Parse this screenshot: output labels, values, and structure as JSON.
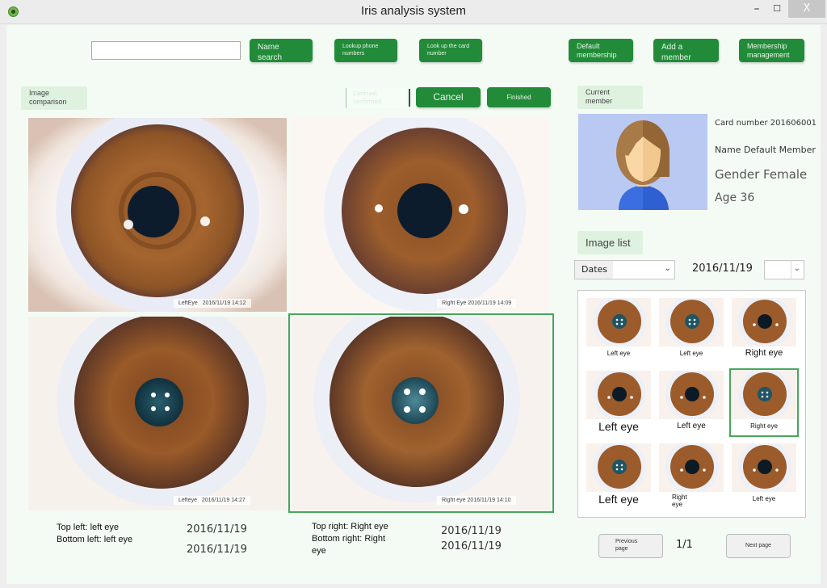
{
  "window": {
    "title": "Iris analysis system",
    "minimize_glyph": "–",
    "maximize_glyph": "☐",
    "close_glyph": "X"
  },
  "toolbar": {
    "search_value": "",
    "name_search": "Name search",
    "lookup_phone": "Lookup phone numbers",
    "lookup_card": "Look up the card number",
    "default_membership": "Default membership",
    "add_member": "Add a member",
    "membership_management": "Membership management"
  },
  "comparison": {
    "section_label": "Image comparison",
    "faded_button": "Contrast confirmed",
    "cancel": "Cancel",
    "finished": "Finished",
    "images": [
      {
        "caption_eye": "LeftEye",
        "caption_time": "2016/11/19 14:12",
        "position": "top-left"
      },
      {
        "caption_eye": "Right Eye",
        "caption_time": "2016/11/19 14:09",
        "position": "top-right"
      },
      {
        "caption_eye": "Lefteye",
        "caption_time": "2016/11/19 14:27",
        "position": "bottom-left"
      },
      {
        "caption_eye": "Right eye",
        "caption_time": "2016/11/19 14:10",
        "position": "bottom-right",
        "selected": true
      }
    ],
    "left_summary": "Top left: left eye Bottom left: left eye",
    "left_date_1": "2016/11/19",
    "left_date_2": "2016/11/19",
    "right_summary": "Top right: Right eye Bottom right: Right eye",
    "right_date_1": "2016/11/19",
    "right_date_2": "2016/11/19"
  },
  "member": {
    "section_label": "Current member",
    "card_number": "Card number 201606001",
    "name": "Name Default Member",
    "gender": "Gender Female",
    "age": "Age 36"
  },
  "image_list": {
    "section_label": "Image list",
    "dates_label": "Dates",
    "date_value": "2016/11/19",
    "chevron": "⌄",
    "thumbnails": [
      {
        "label": "Left eye",
        "pupil": "teal"
      },
      {
        "label": "Left eye",
        "pupil": "teal"
      },
      {
        "label": "Right eye",
        "pupil": "black"
      },
      {
        "label": "Left eye",
        "pupil": "black"
      },
      {
        "label": "Left eye",
        "pupil": "black"
      },
      {
        "label": "Right eye",
        "pupil": "teal",
        "selected": true
      },
      {
        "label": "Left eye",
        "pupil": "teal"
      },
      {
        "label": "Right eye",
        "pupil": "black"
      },
      {
        "label": "Left eye",
        "pupil": "black"
      }
    ],
    "previous_page": "Previous page",
    "next_page": "Next page",
    "page_indicator": "1/1"
  },
  "colors": {
    "accent_green": "#228b3a",
    "selection_green": "#46a65a",
    "section_tab_bg": "#dff2df",
    "panel_bg": "#f4fbf4"
  }
}
